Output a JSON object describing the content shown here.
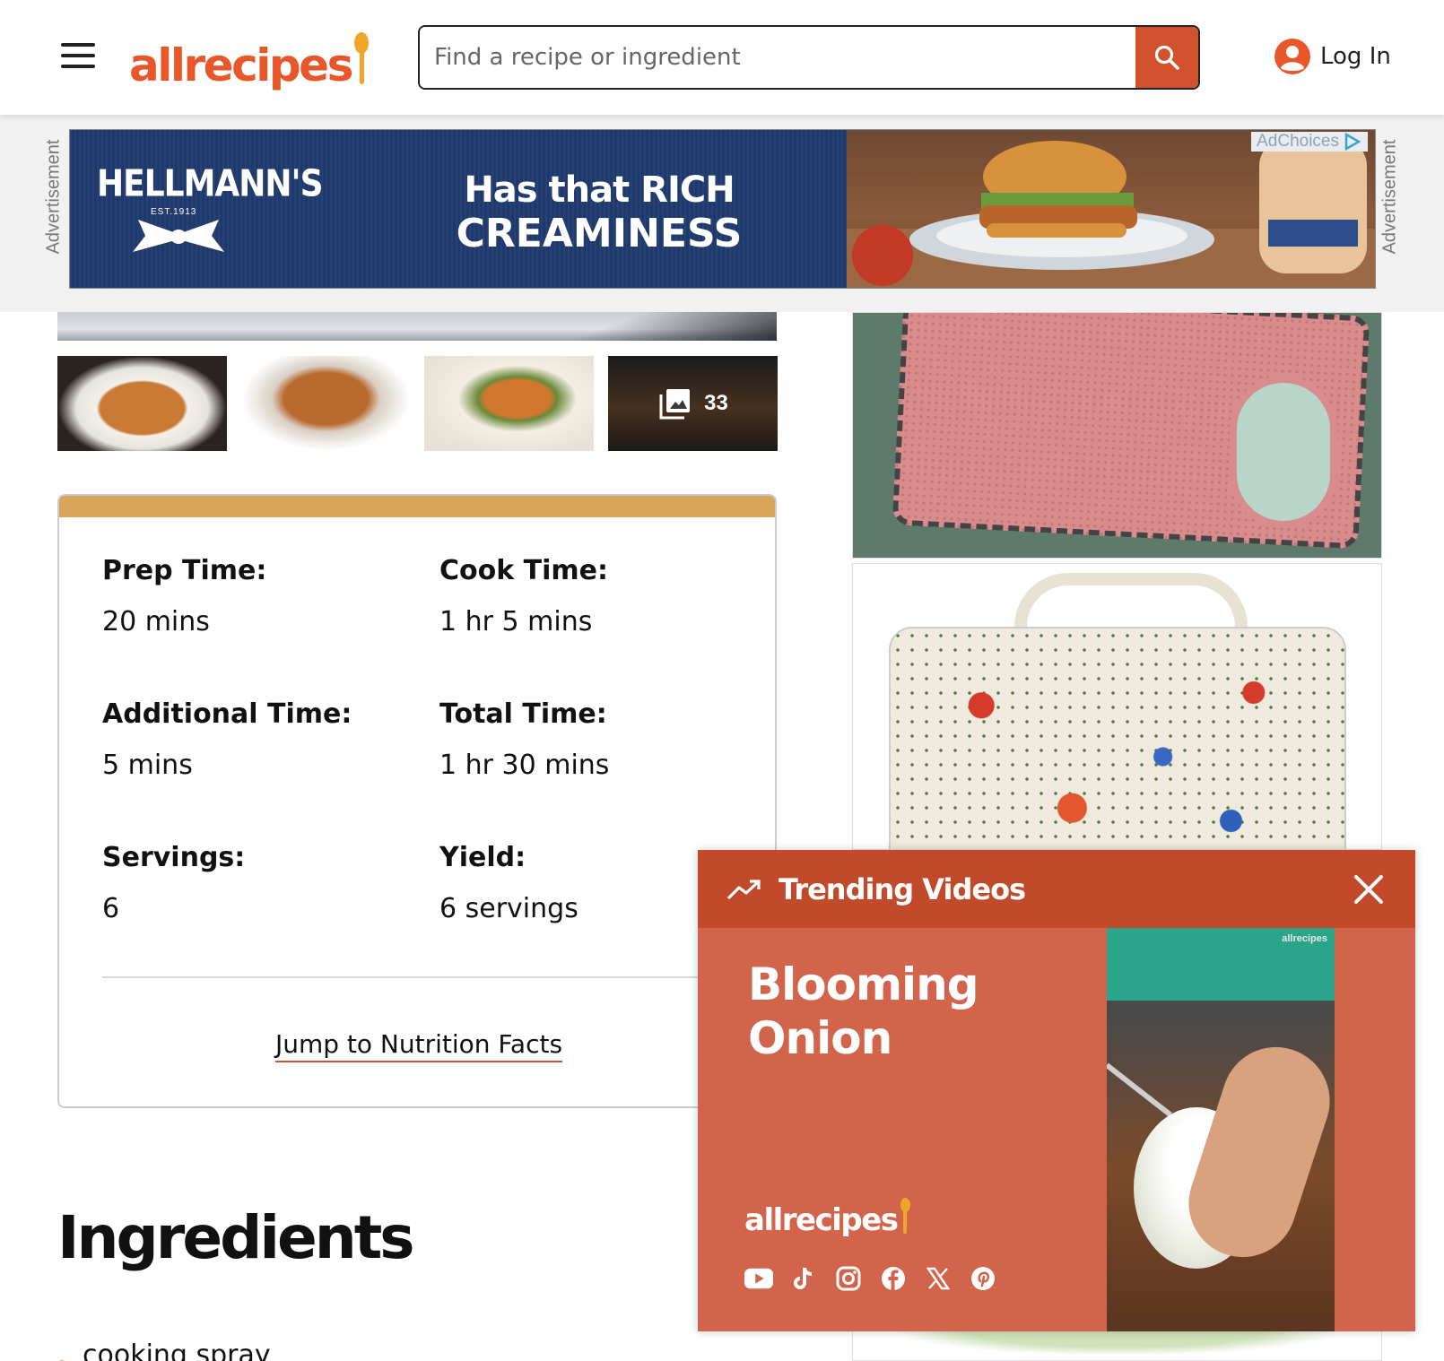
{
  "header": {
    "logo": "allrecipes",
    "search_placeholder": "Find a recipe or ingredient",
    "login_label": "Log In"
  },
  "ad_banner": {
    "side_label": "Advertisement",
    "brand": "HELLMANN'S",
    "brand_est": "EST.1913",
    "line1": "Has that RICH",
    "line2": "CREAMINESS",
    "adchoices": "AdChoices"
  },
  "gallery": {
    "photo_count": "33"
  },
  "recipe_details": {
    "items": [
      {
        "label": "Prep Time:",
        "value": "20 mins"
      },
      {
        "label": "Cook Time:",
        "value": "1 hr 5 mins"
      },
      {
        "label": "Additional Time:",
        "value": "5 mins"
      },
      {
        "label": "Total Time:",
        "value": "1 hr 30 mins"
      },
      {
        "label": "Servings:",
        "value": "6"
      },
      {
        "label": "Yield:",
        "value": "6 servings"
      }
    ],
    "nutrition_link": "Jump to Nutrition Facts"
  },
  "ingredients": {
    "title": "Ingredients",
    "items": [
      "cooking spray"
    ]
  },
  "trending_videos": {
    "title": "Trending Videos",
    "video_title": "Blooming Onion",
    "logo": "allrecipes",
    "watermark": "allrecipes",
    "socials": [
      "youtube-icon",
      "tiktok-icon",
      "instagram-icon",
      "facebook-icon",
      "x-icon",
      "pinterest-icon"
    ]
  },
  "colors": {
    "brand_orange": "#e8572a",
    "accent_gold": "#d9a55a",
    "popup_red": "#d1644a",
    "popup_header": "#c04a2a"
  }
}
